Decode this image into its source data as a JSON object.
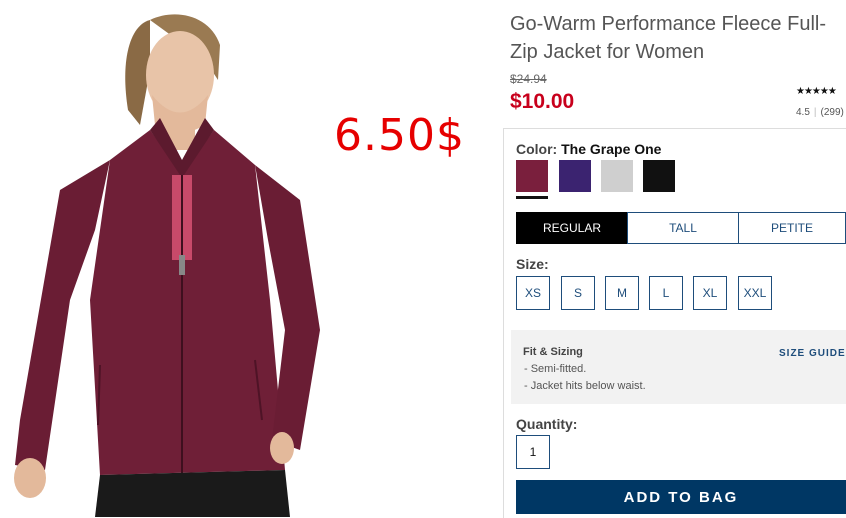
{
  "product": {
    "title": "Go-Warm Performance Fleece Full-Zip Jacket for Women",
    "original_price": "$24.94",
    "sale_price": "$10.00",
    "rating": {
      "stars_display": "★★★★★",
      "value": "4.5",
      "count": "(299)"
    },
    "overlay_price": "6.50$"
  },
  "color": {
    "label": "Color:",
    "selected": "The Grape One",
    "swatches": [
      {
        "name": "grape",
        "hex": "#7a1f3d",
        "selected": true
      },
      {
        "name": "purple",
        "hex": "#3b2370",
        "selected": false
      },
      {
        "name": "light-gray",
        "hex": "#cfcfcf",
        "selected": false
      },
      {
        "name": "black",
        "hex": "#111111",
        "selected": false
      }
    ]
  },
  "fit_tabs": [
    {
      "label": "REGULAR",
      "active": true
    },
    {
      "label": "TALL",
      "active": false
    },
    {
      "label": "PETITE",
      "active": false
    }
  ],
  "size": {
    "label": "Size:",
    "options": [
      "XS",
      "S",
      "M",
      "L",
      "XL",
      "XXL"
    ]
  },
  "fit_sizing": {
    "title": "Fit & Sizing",
    "size_guide": "SIZE GUIDE",
    "lines": [
      "- Semi-fitted.",
      "- Jacket hits below waist."
    ]
  },
  "quantity": {
    "label": "Quantity:",
    "value": "1"
  },
  "cta": {
    "add_to_bag": "ADD TO BAG",
    "color": "#003764"
  },
  "colors": {
    "accent": "#1e4d7b",
    "sale_red": "#c8001c",
    "overlay_red": "#e60000"
  }
}
